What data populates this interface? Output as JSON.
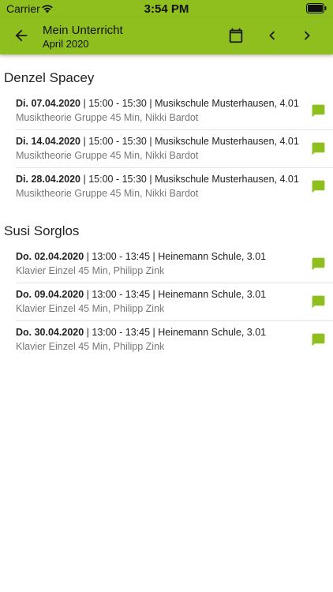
{
  "status_bar": {
    "carrier": "Carrier",
    "time": "3:54 PM"
  },
  "app_bar": {
    "title": "Mein Unterricht",
    "subtitle": "April 2020"
  },
  "colors": {
    "accent": "#8fbf1f",
    "text": "#222222",
    "secondary": "#777777",
    "divider": "#e4e4e4"
  },
  "icons": {
    "back": "arrow-left-icon",
    "calendar": "calendar-icon",
    "prev": "chevron-left-icon",
    "next": "chevron-right-icon",
    "message": "message-icon"
  },
  "groups": [
    {
      "name": "Denzel Spacey",
      "items": [
        {
          "date": "Di. 07.04.2020",
          "rest": " | 15:00 - 15:30 | Musikschule Musterhausen, 4.01",
          "detail": "Musiktheorie Gruppe 45 Min, Nikki Bardot"
        },
        {
          "date": "Di. 14.04.2020",
          "rest": " | 15:00 - 15:30 | Musikschule Musterhausen, 4.01",
          "detail": "Musiktheorie Gruppe 45 Min, Nikki Bardot"
        },
        {
          "date": "Di. 28.04.2020",
          "rest": " | 15:00 - 15:30 | Musikschule Musterhausen, 4.01",
          "detail": "Musiktheorie Gruppe 45 Min, Nikki Bardot"
        }
      ]
    },
    {
      "name": "Susi Sorglos",
      "items": [
        {
          "date": "Do. 02.04.2020",
          "rest": " | 13:00 - 13:45 | Heinemann Schule, 3.01",
          "detail": "Klavier Einzel 45 Min, Philipp Zink"
        },
        {
          "date": "Do. 09.04.2020",
          "rest": " | 13:00 - 13:45 | Heinemann Schule, 3.01",
          "detail": "Klavier Einzel 45 Min, Philipp Zink"
        },
        {
          "date": "Do. 30.04.2020",
          "rest": " | 13:00 - 13:45 | Heinemann Schule, 3.01",
          "detail": "Klavier Einzel 45 Min, Philipp Zink"
        }
      ]
    }
  ]
}
